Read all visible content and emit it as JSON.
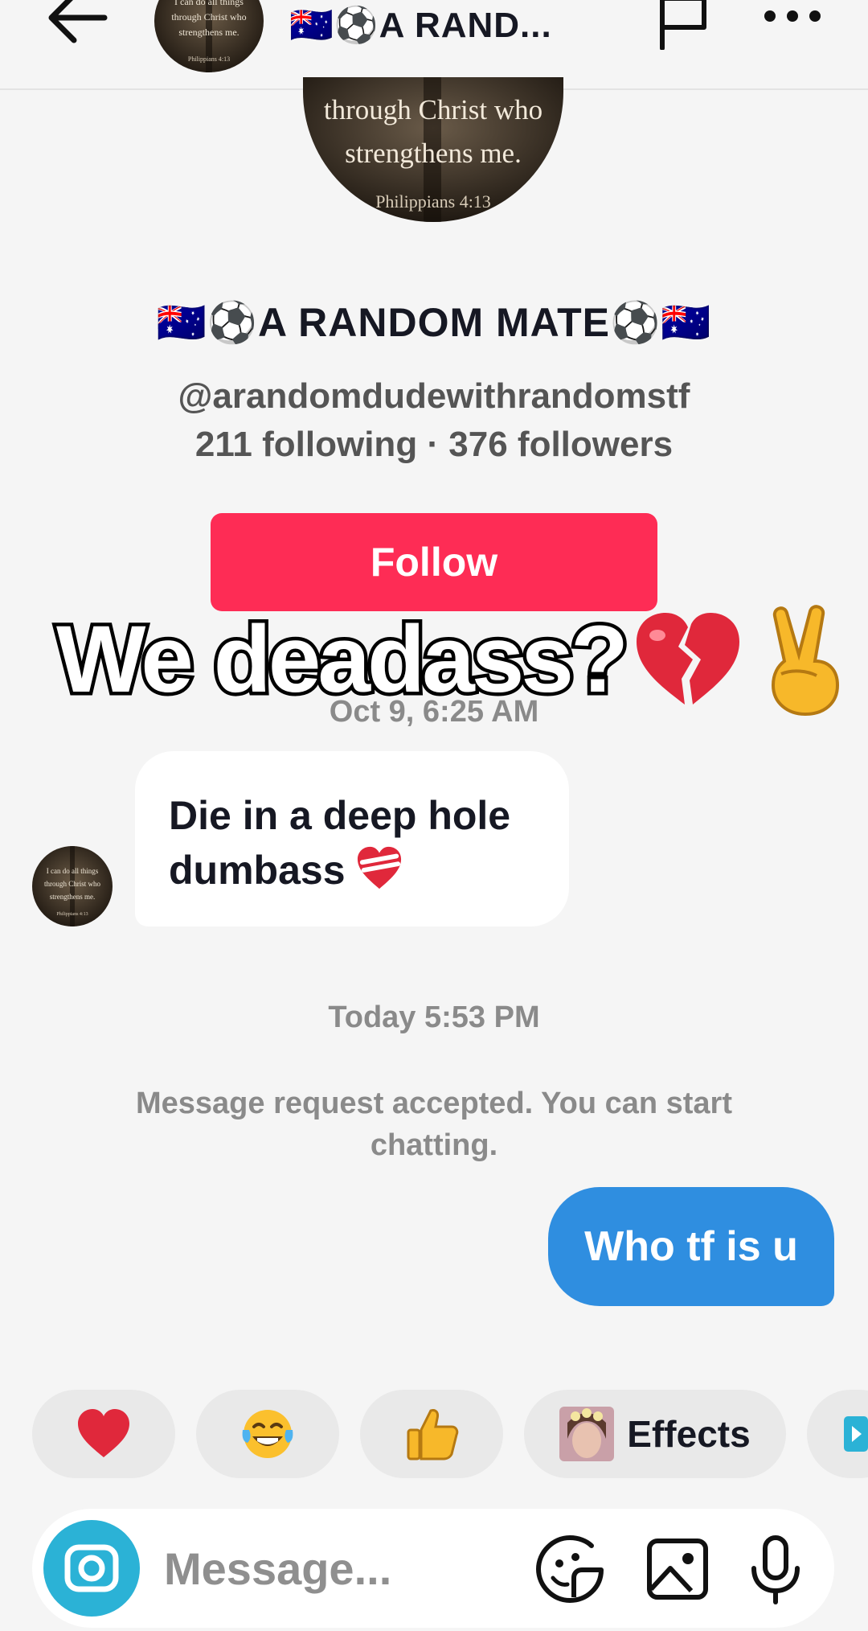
{
  "header": {
    "title": "🇦🇺⚽A RAND..."
  },
  "profile": {
    "display_name": "🇦🇺⚽A RANDOM MATE⚽🇦🇺",
    "handle": "@arandomdudewithrandomstf",
    "stats": "211 following · 376 followers",
    "follow_label": "Follow",
    "avatar_lines": [
      "I can do all things",
      "through Christ who",
      "strengthens me.",
      "Philippians 4:13"
    ]
  },
  "overlay": {
    "caption": "We deadass?"
  },
  "conversation": {
    "date_1": "Oct 9, 6:25 AM",
    "incoming_line1": "Die in a deep hole",
    "incoming_line2": "dumbass",
    "date_2": "Today 5:53 PM",
    "system_message": "Message request accepted. You can start chatting.",
    "outgoing": "Who tf is u"
  },
  "quick_reactions": {
    "items": [
      "red-heart",
      "tears-of-joy",
      "thumbs-up"
    ],
    "effects_label": "Effects"
  },
  "composer": {
    "placeholder": "Message..."
  },
  "colors": {
    "follow": "#fe2c55",
    "outgoing_bubble": "#2f8ee0",
    "camera": "#2bb2d6",
    "background": "#f5f5f5"
  }
}
